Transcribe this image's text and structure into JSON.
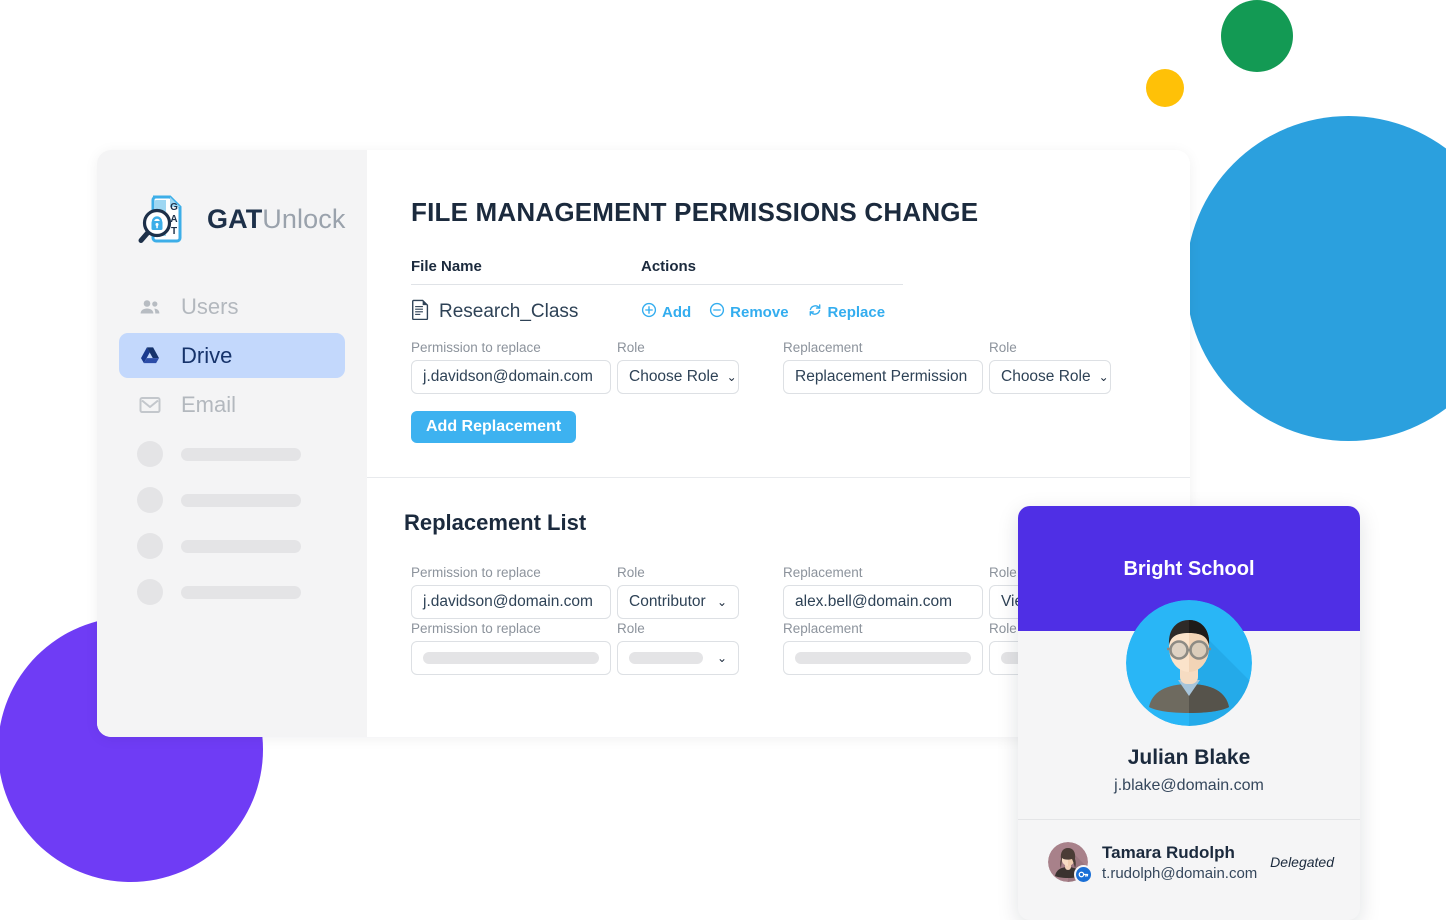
{
  "brand": {
    "name_bold": "GAT",
    "name_light": "Unlock",
    "logo_icon": "gat-unlock-logo",
    "logo_letters": [
      "G",
      "A",
      "T"
    ]
  },
  "sidebar": {
    "items": [
      {
        "label": "Users",
        "icon": "people-icon",
        "active": false
      },
      {
        "label": "Drive",
        "icon": "google-drive-icon",
        "active": true
      },
      {
        "label": "Email",
        "icon": "gmail-envelope-icon",
        "active": false
      }
    ],
    "skeleton_item_count": 4
  },
  "main": {
    "page_title": "FILE MANAGEMENT PERMISSIONS CHANGE",
    "table": {
      "headers": {
        "file_name": "File Name",
        "actions": "Actions"
      },
      "rows": [
        {
          "file_icon": "document-icon",
          "file_name": "Research_Class",
          "actions": [
            {
              "label": "Add",
              "icon": "plus-circle-icon"
            },
            {
              "label": "Remove",
              "icon": "minus-circle-icon"
            },
            {
              "label": "Replace",
              "icon": "refresh-circular-arrows-icon"
            }
          ]
        }
      ]
    },
    "add_form": {
      "labels": {
        "permission_to_replace": "Permission to replace",
        "role": "Role",
        "replacement": "Replacement",
        "replacement_role": "Role"
      },
      "permission_value": "j.davidson@domain.com",
      "role_value": "Choose Role",
      "replacement_value": "Replacement Permission",
      "replacement_role_value": "Choose Role",
      "submit_label": "Add Replacement"
    },
    "replacement_list": {
      "title": "Replacement List",
      "labels": {
        "permission_to_replace": "Permission to replace",
        "role": "Role",
        "replacement": "Replacement",
        "replacement_role": "Role"
      },
      "rows": [
        {
          "permission_value": "j.davidson@domain.com",
          "role_value": "Contributor",
          "replacement_value": "alex.bell@domain.com",
          "replacement_role_value": "View",
          "placeholder": false
        },
        {
          "permission_value": "",
          "role_value": "",
          "replacement_value": "",
          "replacement_role_value": "",
          "placeholder": true
        }
      ]
    }
  },
  "profile_card": {
    "org_name": "Bright School",
    "avatar_icon": "user-avatar-glasses",
    "user_name": "Julian Blake",
    "user_email": "j.blake@domain.com",
    "delegate": {
      "avatar_icon": "user-avatar-female",
      "badge_icon": "key-icon",
      "name": "Tamara Rudolph",
      "email": "t.rudolph@domain.com",
      "status": "Delegated"
    }
  },
  "colors": {
    "accent_blue": "#33ADEF",
    "button_blue": "#3DB2F0",
    "card_purple": "#4F2FE5",
    "nav_active_bg": "#C3D8FC",
    "nav_active_text": "#16336B",
    "blob_green": "#139A54",
    "blob_yellow": "#FFC107",
    "blob_blue": "#2BA0DE",
    "blob_purple": "#6F3CF5",
    "heading": "#1B2A3D"
  }
}
